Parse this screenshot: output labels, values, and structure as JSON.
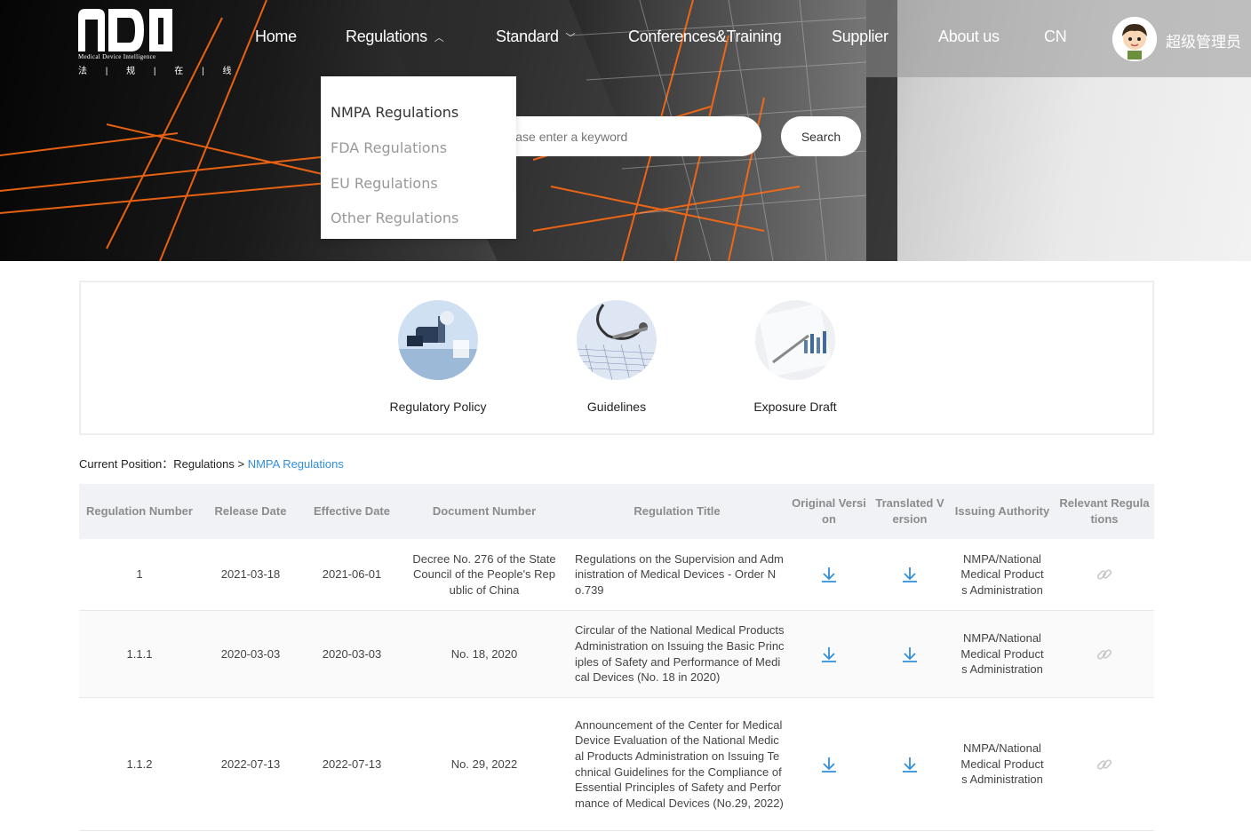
{
  "header": {
    "logo_en": "Medical Device Intelligence",
    "logo_cn": "法 | 规 | 在 | 线",
    "nav": [
      {
        "label": "Home"
      },
      {
        "label": "Regulations"
      },
      {
        "label": "Standard"
      },
      {
        "label": "Conferences&Training"
      },
      {
        "label": "Supplier"
      },
      {
        "label": "About us"
      },
      {
        "label": "CN"
      }
    ],
    "username": "超级管理员"
  },
  "regulations_menu": {
    "items": [
      "NMPA Regulations",
      "FDA Regulations",
      "EU Regulations",
      "Other Regulations"
    ]
  },
  "search": {
    "placeholder": "Please enter a keyword",
    "button_label": "Search"
  },
  "categories": [
    {
      "label": "Regulatory Policy"
    },
    {
      "label": "Guidelines"
    },
    {
      "label": "Exposure Draft"
    }
  ],
  "breadcrumb": {
    "prefix": "Current Position：",
    "section": "Regulations",
    "separator": " > ",
    "current": "NMPA Regulations"
  },
  "table": {
    "headers": [
      "Regulation Number",
      "Release Date",
      "Effective Date",
      "Document Number",
      "Regulation Title",
      "Original Version",
      "Translated Version",
      "Issuing Authority",
      "Relevant Regulations"
    ],
    "rows": [
      {
        "number": "1",
        "release": "2021-03-18",
        "effective": "2021-06-01",
        "doc_no": "Decree No. 276 of the State Council of the People's Republic of China",
        "title": "Regulations on the Supervision and Administration of Medical Devices - Order No.739",
        "authority": "NMPA/National Medical Products Administration"
      },
      {
        "number": "1.1.1",
        "release": "2020-03-03",
        "effective": "2020-03-03",
        "doc_no": "No. 18, 2020",
        "title": "Circular of the National Medical Products Administration on Issuing the Basic Principles of Safety and Performance of Medical Devices (No. 18 in 2020)",
        "authority": "NMPA/National Medical Products Administration"
      },
      {
        "number": "1.1.2",
        "release": "2022-07-13",
        "effective": "2022-07-13",
        "doc_no": "No. 29, 2022",
        "title": "Announcement of the Center for Medical Device Evaluation of the National Medical Products Administration on Issuing Technical Guidelines for the Compliance of Essential Principles of Safety and Performance of Medical Devices (No.29, 2022)",
        "authority": "NMPA/National Medical Products Administration"
      }
    ]
  },
  "icons": {
    "download": "download-icon",
    "relevant": "link-icon",
    "menu_open": "chevron-up-icon",
    "menu_closed": "chevron-down-icon"
  },
  "colors": {
    "accent": "#2f8fdd",
    "header_bg": "#f0f2f5",
    "hero_orange": "#ff6a13"
  }
}
